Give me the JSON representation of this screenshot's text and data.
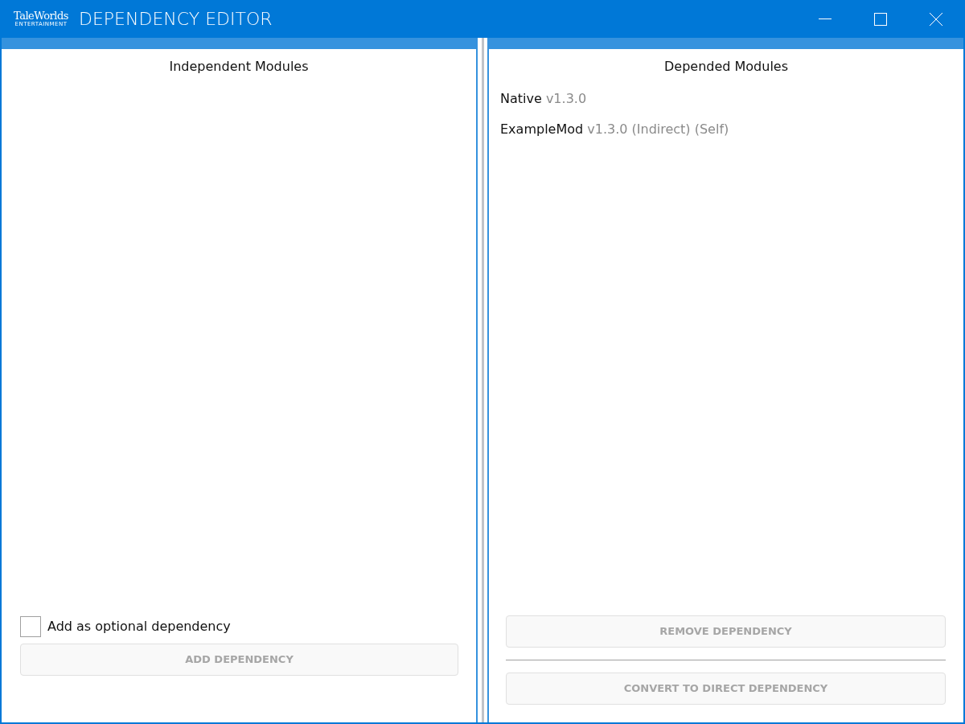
{
  "window": {
    "logo": "TaleWorlds",
    "logo_subtitle": "ENTERTAINMENT",
    "title": "DEPENDENCY EDITOR"
  },
  "left_panel": {
    "title": "Independent Modules",
    "optional_checkbox": {
      "label": "Add as optional dependency",
      "checked": false
    },
    "add_button": {
      "label": "ADD DEPENDENCY",
      "disabled": true
    }
  },
  "right_panel": {
    "title": "Depended Modules",
    "modules": [
      {
        "name": "Native",
        "detail": "v1.3.0"
      },
      {
        "name": "ExampleMod",
        "detail": "v1.3.0 (Indirect) (Self)"
      }
    ],
    "remove_button": {
      "label": "REMOVE DEPENDENCY",
      "disabled": true
    },
    "convert_button": {
      "label": "CONVERT TO DIRECT DEPENDENCY",
      "disabled": true
    }
  }
}
